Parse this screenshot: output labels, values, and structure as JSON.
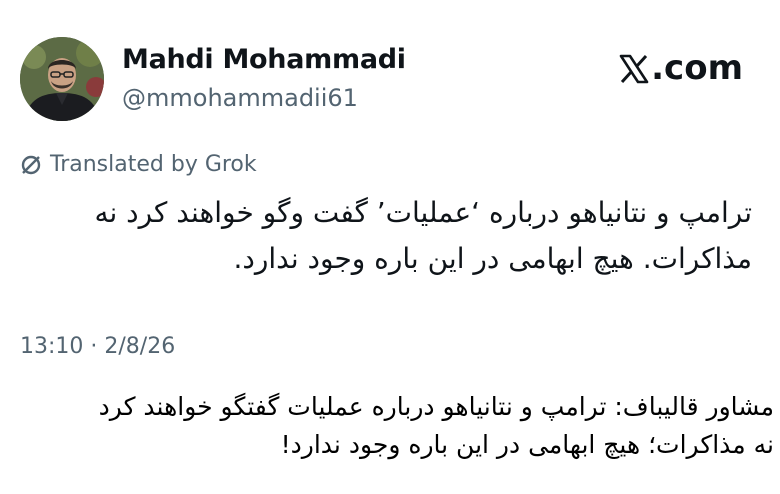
{
  "profile": {
    "display_name": "Mahdi Mohammadi",
    "handle": "@mmohammadii61"
  },
  "brand": {
    "label": ".com",
    "logo_icon": "x-logo-icon"
  },
  "translation": {
    "label": "Translated by Grok",
    "icon": "translate-slash-icon"
  },
  "tweet": {
    "line1": "ترامپ و نتانیاهو درباره ‘عملیات’ گفت وگو خواهند کرد نه",
    "line2": "مذاکرات. هیچ ابهامی در این باره وجود ندارد.",
    "timestamp": "13:10 · 2/8/26"
  },
  "caption": {
    "line1": "مشاور قالیباف: ترامپ و نتانیاهو درباره عملیات گفتگو خواهند کرد",
    "line2": "نه مذاکرات؛ هیچ ابهامی در این باره وجود ندارد!"
  },
  "colors": {
    "text_primary": "#0f1419",
    "text_secondary": "#536471",
    "background": "#ffffff"
  }
}
